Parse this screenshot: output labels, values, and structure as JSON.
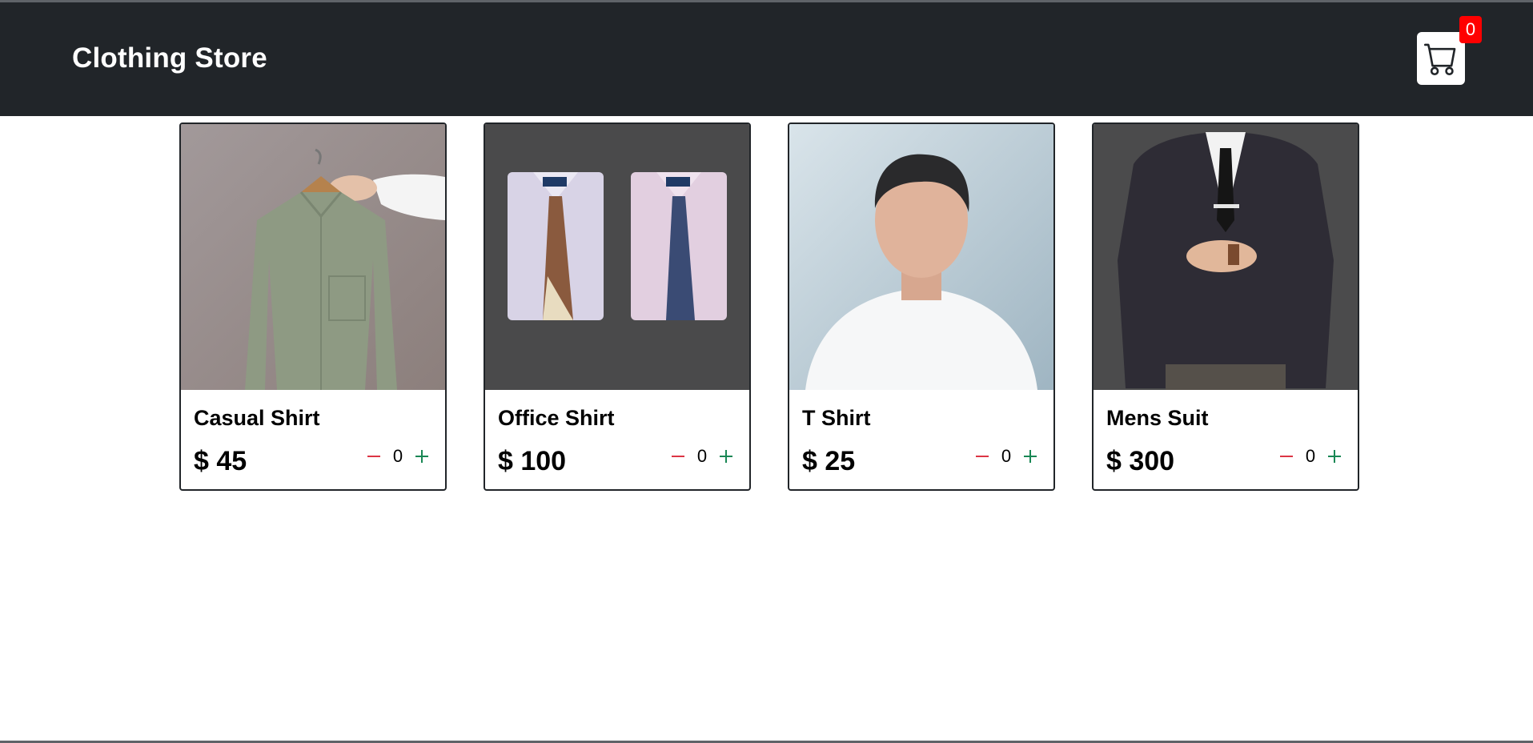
{
  "header": {
    "brand": "Clothing Store",
    "cart_count": "0"
  },
  "products": [
    {
      "name": "Casual Shirt",
      "price": "$ 45",
      "quantity": "0"
    },
    {
      "name": "Office Shirt",
      "price": "$ 100",
      "quantity": "0"
    },
    {
      "name": "T Shirt",
      "price": "$ 25",
      "quantity": "0"
    },
    {
      "name": "Mens Suit",
      "price": "$ 300",
      "quantity": "0"
    }
  ],
  "icons": {
    "cart": "cart-icon",
    "minus": "minus-icon",
    "plus": "plus-icon"
  },
  "colors": {
    "navbar": "#212529",
    "badge": "#ff0000",
    "minus": "#dc3545",
    "plus": "#198754"
  }
}
